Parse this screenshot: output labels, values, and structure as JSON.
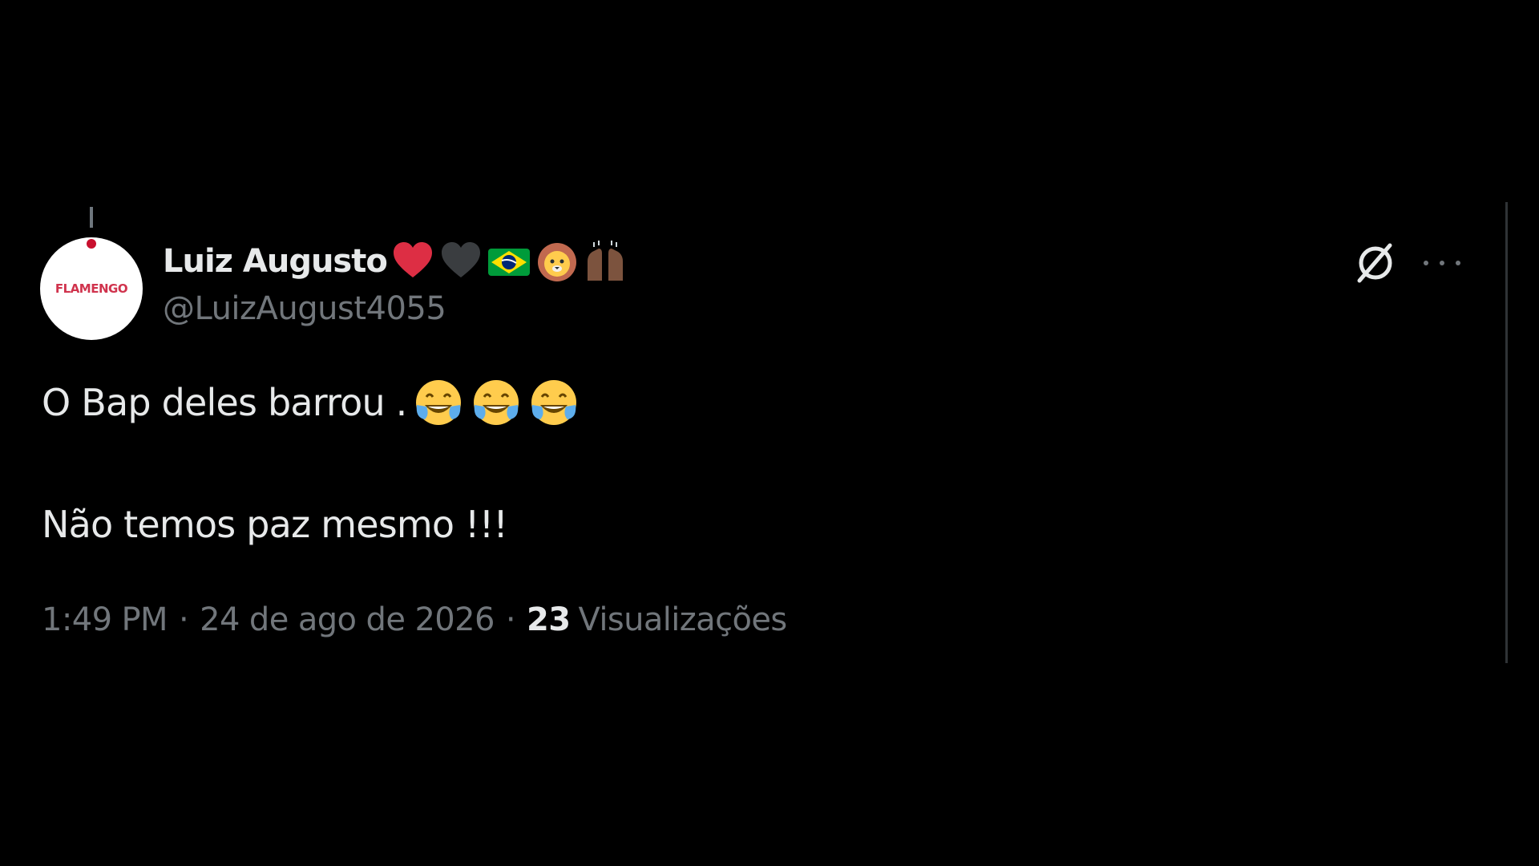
{
  "colors": {
    "background": "#000000",
    "primary_text": "#e7e9ea",
    "secondary_text": "#71767b",
    "border": "#2f3336",
    "avatar_accent": "#c8102e"
  },
  "author": {
    "display_name": "Luiz Augusto",
    "name_emojis": [
      "red-heart-emoji",
      "black-heart-emoji",
      "brazil-flag-emoji",
      "lion-face-emoji",
      "raising-hands-emoji"
    ],
    "handle": "@LuizAugust4055",
    "avatar_logo_text": "FLAMENGO"
  },
  "actions": {
    "grok_icon": "grok-icon",
    "more_icon": "more-icon"
  },
  "tweet": {
    "line1": "O Bap deles barrou .",
    "line1_emojis": [
      "tears-of-joy-emoji",
      "tears-of-joy-emoji",
      "tears-of-joy-emoji"
    ],
    "line2": "Não temos paz mesmo !!!"
  },
  "meta": {
    "time": "1:49 PM",
    "separator": "·",
    "date": "24 de ago de 2026",
    "views_count": "23",
    "views_label": "Visualizações"
  }
}
